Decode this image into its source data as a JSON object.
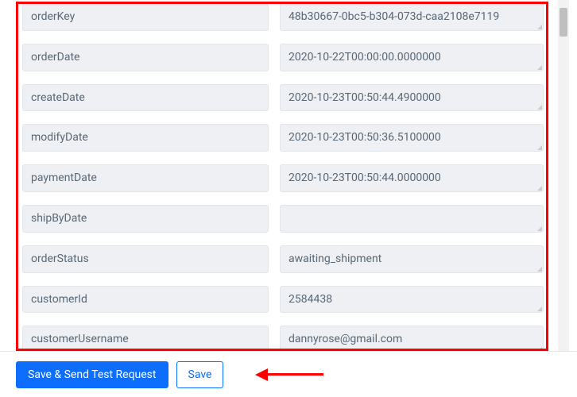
{
  "fields": [
    {
      "key": "orderKey",
      "value": "48b30667-0bc5-b304-073d-caa2108e7119"
    },
    {
      "key": "orderDate",
      "value": "2020-10-22T00:00:00.0000000"
    },
    {
      "key": "createDate",
      "value": "2020-10-23T00:50:44.4900000"
    },
    {
      "key": "modifyDate",
      "value": "2020-10-23T00:50:36.5100000"
    },
    {
      "key": "paymentDate",
      "value": "2020-10-23T00:50:44.0000000"
    },
    {
      "key": "shipByDate",
      "value": ""
    },
    {
      "key": "orderStatus",
      "value": "awaiting_shipment"
    },
    {
      "key": "customerId",
      "value": "2584438"
    },
    {
      "key": "customerUsername",
      "value": "dannyrose@gmail.com"
    }
  ],
  "footer": {
    "save_send_label": "Save & Send Test Request",
    "save_label": "Save"
  }
}
